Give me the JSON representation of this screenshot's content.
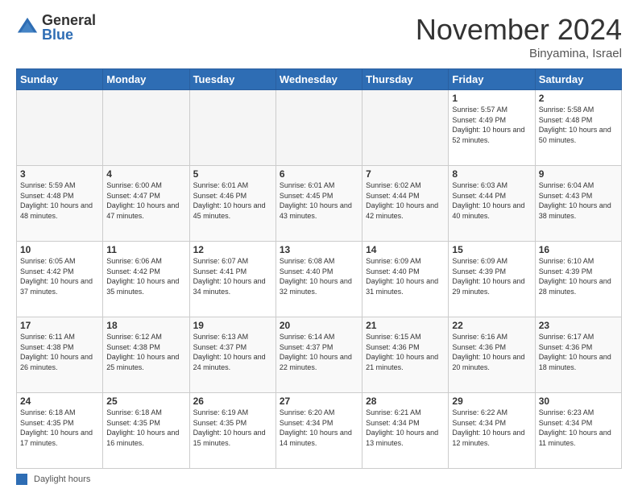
{
  "header": {
    "logo_general": "General",
    "logo_blue": "Blue",
    "month_title": "November 2024",
    "location": "Binyamina, Israel"
  },
  "weekdays": [
    "Sunday",
    "Monday",
    "Tuesday",
    "Wednesday",
    "Thursday",
    "Friday",
    "Saturday"
  ],
  "footer": {
    "legend_label": "Daylight hours"
  },
  "days": [
    {
      "date": "",
      "sunrise": "",
      "sunset": "",
      "daylight": ""
    },
    {
      "date": "",
      "sunrise": "",
      "sunset": "",
      "daylight": ""
    },
    {
      "date": "",
      "sunrise": "",
      "sunset": "",
      "daylight": ""
    },
    {
      "date": "",
      "sunrise": "",
      "sunset": "",
      "daylight": ""
    },
    {
      "date": "",
      "sunrise": "",
      "sunset": "",
      "daylight": ""
    },
    {
      "date": "1",
      "sunrise": "Sunrise: 5:57 AM",
      "sunset": "Sunset: 4:49 PM",
      "daylight": "Daylight: 10 hours and 52 minutes."
    },
    {
      "date": "2",
      "sunrise": "Sunrise: 5:58 AM",
      "sunset": "Sunset: 4:48 PM",
      "daylight": "Daylight: 10 hours and 50 minutes."
    },
    {
      "date": "3",
      "sunrise": "Sunrise: 5:59 AM",
      "sunset": "Sunset: 4:48 PM",
      "daylight": "Daylight: 10 hours and 48 minutes."
    },
    {
      "date": "4",
      "sunrise": "Sunrise: 6:00 AM",
      "sunset": "Sunset: 4:47 PM",
      "daylight": "Daylight: 10 hours and 47 minutes."
    },
    {
      "date": "5",
      "sunrise": "Sunrise: 6:01 AM",
      "sunset": "Sunset: 4:46 PM",
      "daylight": "Daylight: 10 hours and 45 minutes."
    },
    {
      "date": "6",
      "sunrise": "Sunrise: 6:01 AM",
      "sunset": "Sunset: 4:45 PM",
      "daylight": "Daylight: 10 hours and 43 minutes."
    },
    {
      "date": "7",
      "sunrise": "Sunrise: 6:02 AM",
      "sunset": "Sunset: 4:44 PM",
      "daylight": "Daylight: 10 hours and 42 minutes."
    },
    {
      "date": "8",
      "sunrise": "Sunrise: 6:03 AM",
      "sunset": "Sunset: 4:44 PM",
      "daylight": "Daylight: 10 hours and 40 minutes."
    },
    {
      "date": "9",
      "sunrise": "Sunrise: 6:04 AM",
      "sunset": "Sunset: 4:43 PM",
      "daylight": "Daylight: 10 hours and 38 minutes."
    },
    {
      "date": "10",
      "sunrise": "Sunrise: 6:05 AM",
      "sunset": "Sunset: 4:42 PM",
      "daylight": "Daylight: 10 hours and 37 minutes."
    },
    {
      "date": "11",
      "sunrise": "Sunrise: 6:06 AM",
      "sunset": "Sunset: 4:42 PM",
      "daylight": "Daylight: 10 hours and 35 minutes."
    },
    {
      "date": "12",
      "sunrise": "Sunrise: 6:07 AM",
      "sunset": "Sunset: 4:41 PM",
      "daylight": "Daylight: 10 hours and 34 minutes."
    },
    {
      "date": "13",
      "sunrise": "Sunrise: 6:08 AM",
      "sunset": "Sunset: 4:40 PM",
      "daylight": "Daylight: 10 hours and 32 minutes."
    },
    {
      "date": "14",
      "sunrise": "Sunrise: 6:09 AM",
      "sunset": "Sunset: 4:40 PM",
      "daylight": "Daylight: 10 hours and 31 minutes."
    },
    {
      "date": "15",
      "sunrise": "Sunrise: 6:09 AM",
      "sunset": "Sunset: 4:39 PM",
      "daylight": "Daylight: 10 hours and 29 minutes."
    },
    {
      "date": "16",
      "sunrise": "Sunrise: 6:10 AM",
      "sunset": "Sunset: 4:39 PM",
      "daylight": "Daylight: 10 hours and 28 minutes."
    },
    {
      "date": "17",
      "sunrise": "Sunrise: 6:11 AM",
      "sunset": "Sunset: 4:38 PM",
      "daylight": "Daylight: 10 hours and 26 minutes."
    },
    {
      "date": "18",
      "sunrise": "Sunrise: 6:12 AM",
      "sunset": "Sunset: 4:38 PM",
      "daylight": "Daylight: 10 hours and 25 minutes."
    },
    {
      "date": "19",
      "sunrise": "Sunrise: 6:13 AM",
      "sunset": "Sunset: 4:37 PM",
      "daylight": "Daylight: 10 hours and 24 minutes."
    },
    {
      "date": "20",
      "sunrise": "Sunrise: 6:14 AM",
      "sunset": "Sunset: 4:37 PM",
      "daylight": "Daylight: 10 hours and 22 minutes."
    },
    {
      "date": "21",
      "sunrise": "Sunrise: 6:15 AM",
      "sunset": "Sunset: 4:36 PM",
      "daylight": "Daylight: 10 hours and 21 minutes."
    },
    {
      "date": "22",
      "sunrise": "Sunrise: 6:16 AM",
      "sunset": "Sunset: 4:36 PM",
      "daylight": "Daylight: 10 hours and 20 minutes."
    },
    {
      "date": "23",
      "sunrise": "Sunrise: 6:17 AM",
      "sunset": "Sunset: 4:36 PM",
      "daylight": "Daylight: 10 hours and 18 minutes."
    },
    {
      "date": "24",
      "sunrise": "Sunrise: 6:18 AM",
      "sunset": "Sunset: 4:35 PM",
      "daylight": "Daylight: 10 hours and 17 minutes."
    },
    {
      "date": "25",
      "sunrise": "Sunrise: 6:18 AM",
      "sunset": "Sunset: 4:35 PM",
      "daylight": "Daylight: 10 hours and 16 minutes."
    },
    {
      "date": "26",
      "sunrise": "Sunrise: 6:19 AM",
      "sunset": "Sunset: 4:35 PM",
      "daylight": "Daylight: 10 hours and 15 minutes."
    },
    {
      "date": "27",
      "sunrise": "Sunrise: 6:20 AM",
      "sunset": "Sunset: 4:34 PM",
      "daylight": "Daylight: 10 hours and 14 minutes."
    },
    {
      "date": "28",
      "sunrise": "Sunrise: 6:21 AM",
      "sunset": "Sunset: 4:34 PM",
      "daylight": "Daylight: 10 hours and 13 minutes."
    },
    {
      "date": "29",
      "sunrise": "Sunrise: 6:22 AM",
      "sunset": "Sunset: 4:34 PM",
      "daylight": "Daylight: 10 hours and 12 minutes."
    },
    {
      "date": "30",
      "sunrise": "Sunrise: 6:23 AM",
      "sunset": "Sunset: 4:34 PM",
      "daylight": "Daylight: 10 hours and 11 minutes."
    }
  ]
}
